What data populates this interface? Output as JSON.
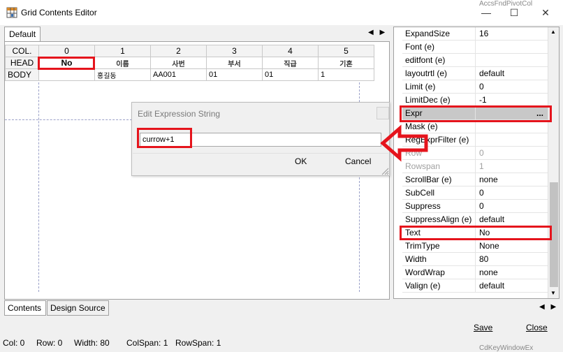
{
  "window": {
    "title": "Grid Contents Editor",
    "bg_ghost_text": "AccsFndPivotCol",
    "bg_ghost_bottom": "CdKeyWindowEx"
  },
  "window_controls": {
    "minimize": "—",
    "maximize": "☐",
    "close": "✕"
  },
  "grid_tab": {
    "label": "Default",
    "nav": "◀ ▶"
  },
  "grid": {
    "col_label": "COL.",
    "col_numbers": [
      "0",
      "1",
      "2",
      "3",
      "4",
      "5"
    ],
    "head_label": "HEAD",
    "head_cells": [
      "No",
      "이름",
      "사번",
      "부서",
      "직급",
      "기혼"
    ],
    "body_label": "BODY",
    "body_cells": [
      "",
      "홍길동",
      "AA001",
      "01",
      "01",
      "1"
    ]
  },
  "dialog": {
    "title": "Edit Expression String",
    "expression_value": "currow+1",
    "ok_label": "OK",
    "cancel_label": "Cancel"
  },
  "properties": [
    {
      "name": "ExpandSize",
      "value": "16",
      "state": "normal"
    },
    {
      "name": "Font (e)",
      "value": "",
      "state": "normal"
    },
    {
      "name": "editfont (e)",
      "value": "",
      "state": "normal"
    },
    {
      "name": "layoutrtl (e)",
      "value": "default",
      "state": "normal"
    },
    {
      "name": "Limit (e)",
      "value": "0",
      "state": "normal"
    },
    {
      "name": "LimitDec (e)",
      "value": "-1",
      "state": "normal"
    },
    {
      "name": "Expr",
      "value": "...",
      "state": "selected"
    },
    {
      "name": "Mask (e)",
      "value": "",
      "state": "normal"
    },
    {
      "name": "RegExprFilter (e)",
      "value": "",
      "state": "normal"
    },
    {
      "name": "Row",
      "value": "0",
      "state": "disabled"
    },
    {
      "name": "Rowspan",
      "value": "1",
      "state": "disabled"
    },
    {
      "name": "ScrollBar (e)",
      "value": "none",
      "state": "normal"
    },
    {
      "name": "SubCell",
      "value": "0",
      "state": "normal"
    },
    {
      "name": "Suppress",
      "value": "0",
      "state": "normal"
    },
    {
      "name": "SuppressAlign (e)",
      "value": "default",
      "state": "normal"
    },
    {
      "name": "Text",
      "value": "No",
      "state": "normal"
    },
    {
      "name": "TrimType",
      "value": "None",
      "state": "normal"
    },
    {
      "name": "Width",
      "value": "80",
      "state": "normal"
    },
    {
      "name": "WordWrap",
      "value": "none",
      "state": "normal"
    },
    {
      "name": "Valign (e)",
      "value": "default",
      "state": "normal"
    }
  ],
  "bottom_tabs": {
    "contents": "Contents",
    "design_source": "Design Source",
    "nav": "◀ ▶"
  },
  "footer": {
    "save_label": "Save",
    "close_label": "Close"
  },
  "status_bar": {
    "col": "Col: 0",
    "row": "Row: 0",
    "width": "Width: 80",
    "colspan": "ColSpan: 1",
    "rowspan": "RowSpan: 1"
  },
  "colors": {
    "annotation_red": "#e5141c",
    "selected_row": "#c8c8c8",
    "disabled_text": "#a0a0a0"
  },
  "icons": {
    "app": "grid-editor-icon",
    "dialog_close": "close-icon",
    "arrow": "red-arrow-left-icon",
    "grip": "resize-grip-icon"
  }
}
